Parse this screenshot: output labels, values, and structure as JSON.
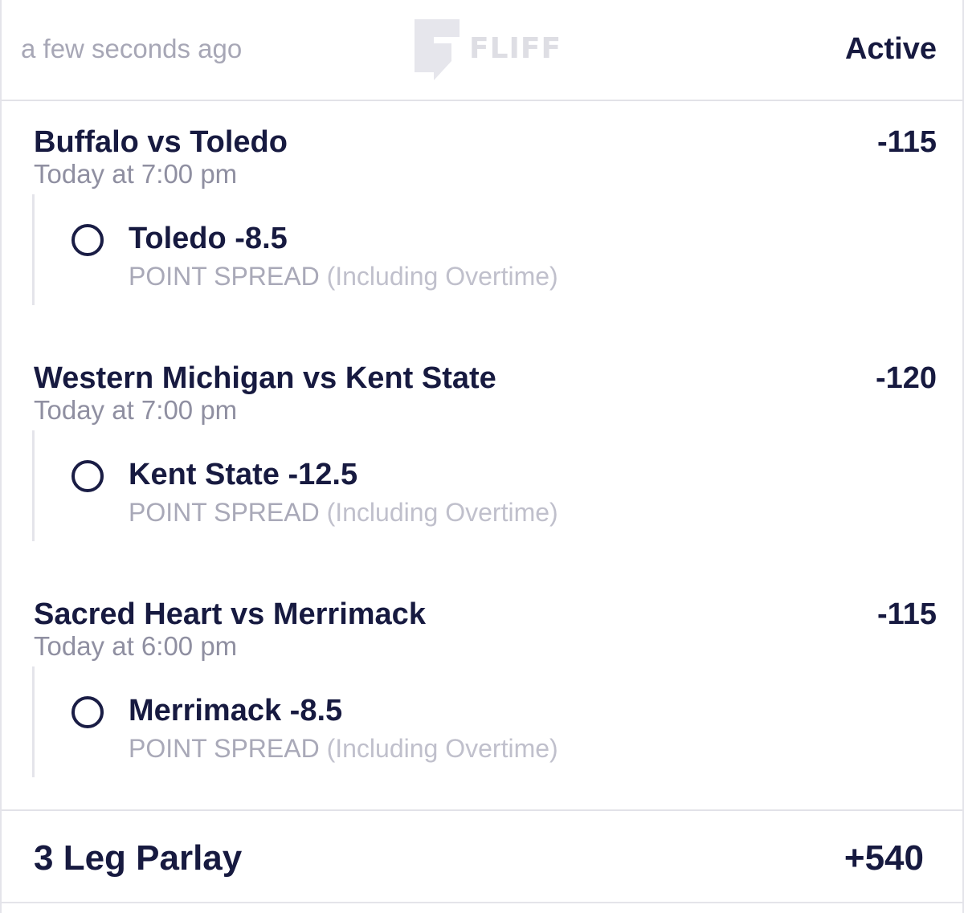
{
  "header": {
    "timestamp": "a few seconds ago",
    "logo_text": "FLIFF",
    "status": "Active"
  },
  "legs": [
    {
      "game": "Buffalo vs Toledo",
      "time": "Today at 7:00 pm",
      "odds": "-115",
      "pick": "Toledo -8.5",
      "market": "POINT SPREAD",
      "market_note": "(Including Overtime)"
    },
    {
      "game": "Western Michigan vs Kent State",
      "time": "Today at 7:00 pm",
      "odds": "-120",
      "pick": "Kent State -12.5",
      "market": "POINT SPREAD",
      "market_note": "(Including Overtime)"
    },
    {
      "game": "Sacred Heart vs Merrimack",
      "time": "Today at 6:00 pm",
      "odds": "-115",
      "pick": "Merrimack -8.5",
      "market": "POINT SPREAD",
      "market_note": "(Including Overtime)"
    }
  ],
  "parlay": {
    "label": "3 Leg Parlay",
    "odds": "+540"
  }
}
